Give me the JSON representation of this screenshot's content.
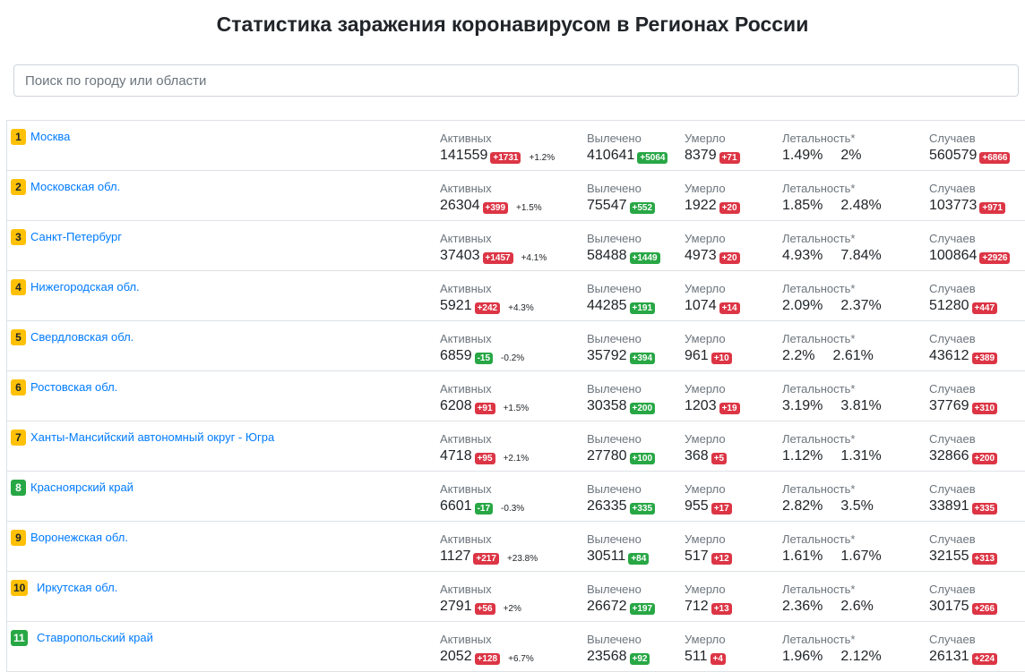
{
  "page": {
    "title": "Статистика заражения коронавирусом в Регионах России",
    "search_placeholder": "Поиск по городу или области"
  },
  "labels": {
    "active": "Активных",
    "recovered": "Вылечено",
    "died": "Умерло",
    "lethality": "Летальность*",
    "cases": "Случаев"
  },
  "colors": {
    "rank_yellow": "#ffc107",
    "rank_green": "#28a745",
    "badge_red": "#dc3545",
    "badge_green": "#28a745",
    "link": "#007bff"
  },
  "regions": [
    {
      "rank": "1",
      "rank_color": "yellow",
      "name": "Москва",
      "active": "141559",
      "active_delta": "+1731",
      "active_delta_color": "red",
      "active_pct": "+1.2%",
      "recovered": "410641",
      "recovered_delta": "+5064",
      "died": "8379",
      "died_delta": "+71",
      "lethality_1": "1.49%",
      "lethality_2": "2%",
      "cases": "560579",
      "cases_delta": "+6866"
    },
    {
      "rank": "2",
      "rank_color": "yellow",
      "name": "Московская обл.",
      "active": "26304",
      "active_delta": "+399",
      "active_delta_color": "red",
      "active_pct": "+1.5%",
      "recovered": "75547",
      "recovered_delta": "+552",
      "died": "1922",
      "died_delta": "+20",
      "lethality_1": "1.85%",
      "lethality_2": "2.48%",
      "cases": "103773",
      "cases_delta": "+971"
    },
    {
      "rank": "3",
      "rank_color": "yellow",
      "name": "Санкт-Петербург",
      "active": "37403",
      "active_delta": "+1457",
      "active_delta_color": "red",
      "active_pct": "+4.1%",
      "recovered": "58488",
      "recovered_delta": "+1449",
      "died": "4973",
      "died_delta": "+20",
      "lethality_1": "4.93%",
      "lethality_2": "7.84%",
      "cases": "100864",
      "cases_delta": "+2926"
    },
    {
      "rank": "4",
      "rank_color": "yellow",
      "name": "Нижегородская обл.",
      "active": "5921",
      "active_delta": "+242",
      "active_delta_color": "red",
      "active_pct": "+4.3%",
      "recovered": "44285",
      "recovered_delta": "+191",
      "died": "1074",
      "died_delta": "+14",
      "lethality_1": "2.09%",
      "lethality_2": "2.37%",
      "cases": "51280",
      "cases_delta": "+447"
    },
    {
      "rank": "5",
      "rank_color": "yellow",
      "name": "Свердловская обл.",
      "active": "6859",
      "active_delta": "-15",
      "active_delta_color": "green",
      "active_pct": "-0.2%",
      "recovered": "35792",
      "recovered_delta": "+394",
      "died": "961",
      "died_delta": "+10",
      "lethality_1": "2.2%",
      "lethality_2": "2.61%",
      "cases": "43612",
      "cases_delta": "+389"
    },
    {
      "rank": "6",
      "rank_color": "yellow",
      "name": "Ростовская обл.",
      "active": "6208",
      "active_delta": "+91",
      "active_delta_color": "red",
      "active_pct": "+1.5%",
      "recovered": "30358",
      "recovered_delta": "+200",
      "died": "1203",
      "died_delta": "+19",
      "lethality_1": "3.19%",
      "lethality_2": "3.81%",
      "cases": "37769",
      "cases_delta": "+310"
    },
    {
      "rank": "7",
      "rank_color": "yellow",
      "name": "Ханты-Мансийский автономный округ - Югра",
      "active": "4718",
      "active_delta": "+95",
      "active_delta_color": "red",
      "active_pct": "+2.1%",
      "recovered": "27780",
      "recovered_delta": "+100",
      "died": "368",
      "died_delta": "+5",
      "lethality_1": "1.12%",
      "lethality_2": "1.31%",
      "cases": "32866",
      "cases_delta": "+200"
    },
    {
      "rank": "8",
      "rank_color": "green",
      "name": "Красноярский край",
      "active": "6601",
      "active_delta": "-17",
      "active_delta_color": "green",
      "active_pct": "-0.3%",
      "recovered": "26335",
      "recovered_delta": "+335",
      "died": "955",
      "died_delta": "+17",
      "lethality_1": "2.82%",
      "lethality_2": "3.5%",
      "cases": "33891",
      "cases_delta": "+335"
    },
    {
      "rank": "9",
      "rank_color": "yellow",
      "name": "Воронежская обл.",
      "active": "1127",
      "active_delta": "+217",
      "active_delta_color": "red",
      "active_pct": "+23.8%",
      "recovered": "30511",
      "recovered_delta": "+84",
      "died": "517",
      "died_delta": "+12",
      "lethality_1": "1.61%",
      "lethality_2": "1.67%",
      "cases": "32155",
      "cases_delta": "+313"
    },
    {
      "rank": "10",
      "rank_color": "yellow",
      "name": "Иркутская обл.",
      "active": "2791",
      "active_delta": "+56",
      "active_delta_color": "red",
      "active_pct": "+2%",
      "recovered": "26672",
      "recovered_delta": "+197",
      "died": "712",
      "died_delta": "+13",
      "lethality_1": "2.36%",
      "lethality_2": "2.6%",
      "cases": "30175",
      "cases_delta": "+266"
    },
    {
      "rank": "11",
      "rank_color": "green",
      "name": "Ставропольский край",
      "active": "2052",
      "active_delta": "+128",
      "active_delta_color": "red",
      "active_pct": "+6.7%",
      "recovered": "23568",
      "recovered_delta": "+92",
      "died": "511",
      "died_delta": "+4",
      "lethality_1": "1.96%",
      "lethality_2": "2.12%",
      "cases": "26131",
      "cases_delta": "+224"
    }
  ]
}
